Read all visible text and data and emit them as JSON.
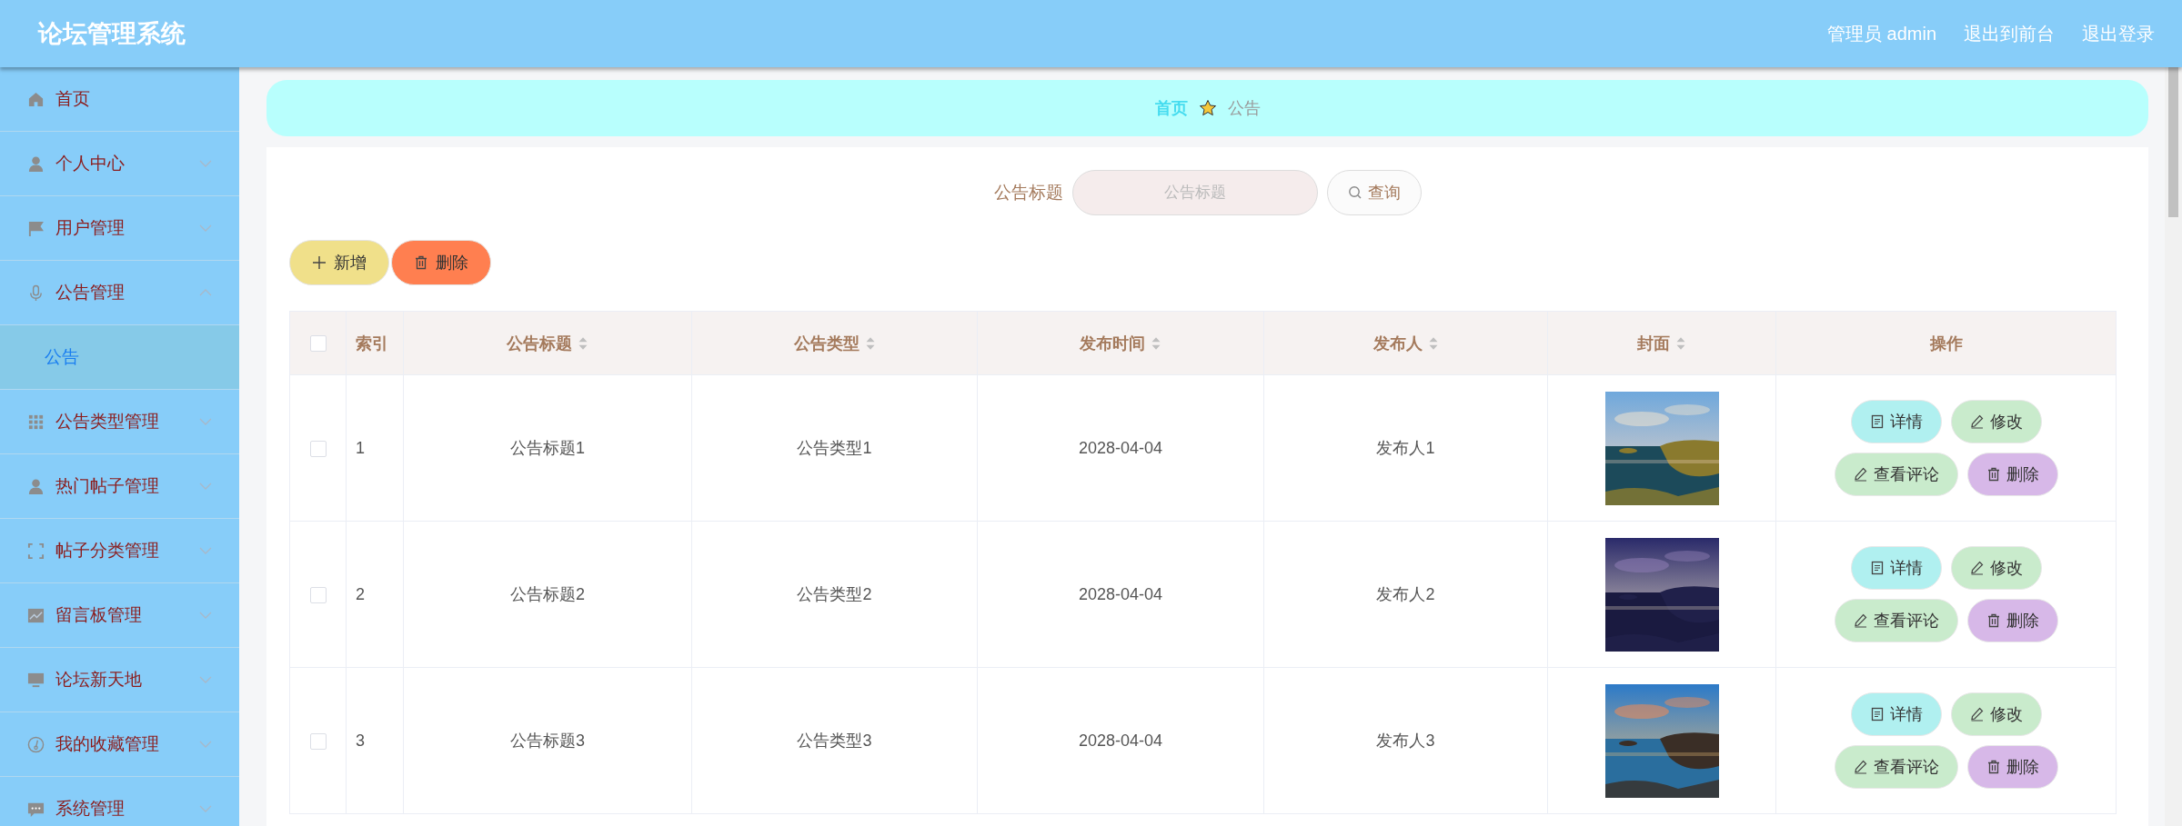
{
  "header": {
    "title": "论坛管理系统",
    "links": [
      "管理员 admin",
      "退出到前台",
      "退出登录"
    ]
  },
  "sidebar": {
    "items": [
      {
        "label": "首页",
        "kind": "link"
      },
      {
        "label": "个人中心",
        "kind": "submenu",
        "expanded": false
      },
      {
        "label": "用户管理",
        "kind": "submenu",
        "expanded": false
      },
      {
        "label": "公告管理",
        "kind": "submenu",
        "expanded": true,
        "children": [
          {
            "label": "公告",
            "selected": true
          }
        ]
      },
      {
        "label": "公告类型管理",
        "kind": "submenu",
        "expanded": false
      },
      {
        "label": "热门帖子管理",
        "kind": "submenu",
        "expanded": false
      },
      {
        "label": "帖子分类管理",
        "kind": "submenu",
        "expanded": false
      },
      {
        "label": "留言板管理",
        "kind": "submenu",
        "expanded": false
      },
      {
        "label": "论坛新天地",
        "kind": "submenu",
        "expanded": false
      },
      {
        "label": "我的收藏管理",
        "kind": "submenu",
        "expanded": false
      },
      {
        "label": "系统管理",
        "kind": "submenu",
        "expanded": false
      }
    ]
  },
  "breadcrumb": [
    "首页",
    "公告"
  ],
  "search": {
    "label": "公告标题",
    "placeholder": "公告标题",
    "button": "查询"
  },
  "toolbar": {
    "add": "新增",
    "delete": "删除"
  },
  "table": {
    "select_all": {
      "checked": false
    },
    "columns": [
      {
        "label": "索引",
        "sortable": false
      },
      {
        "label": "公告标题",
        "sortable": true
      },
      {
        "label": "公告类型",
        "sortable": true
      },
      {
        "label": "发布时间",
        "sortable": true
      },
      {
        "label": "发布人",
        "sortable": true
      },
      {
        "label": "封面",
        "sortable": true
      },
      {
        "label": "操作",
        "sortable": false
      }
    ],
    "rows": [
      {
        "checked": false,
        "index": "1",
        "title": "公告标题1",
        "type": "公告类型1",
        "time": "2028-04-04",
        "author": "发布人1",
        "actions": [
          "详情",
          "修改",
          "查看评论",
          "删除"
        ]
      },
      {
        "checked": false,
        "index": "2",
        "title": "公告标题2",
        "type": "公告类型2",
        "time": "2028-04-04",
        "author": "发布人2",
        "actions": [
          "详情",
          "修改",
          "查看评论",
          "删除"
        ]
      },
      {
        "checked": false,
        "index": "3",
        "title": "公告标题3",
        "type": "公告类型3",
        "time": "2028-04-04",
        "author": "发布人3",
        "actions": [
          "详情",
          "修改",
          "查看评论",
          "删除"
        ]
      }
    ]
  }
}
